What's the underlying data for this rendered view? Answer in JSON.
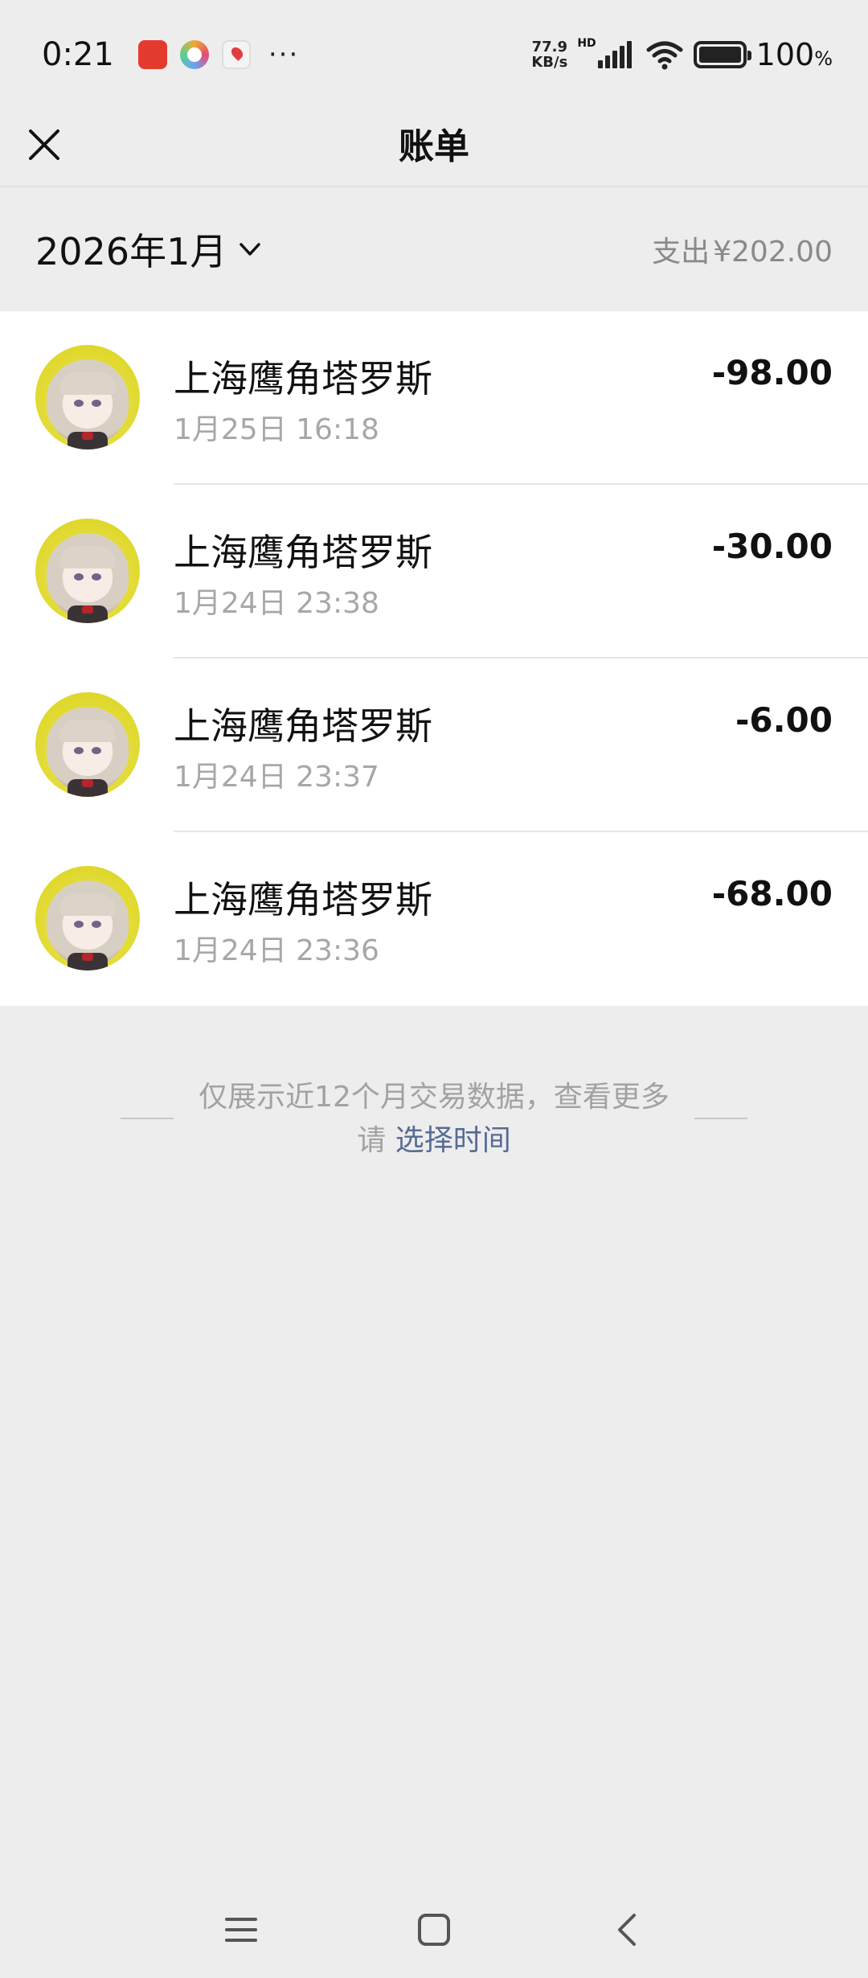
{
  "status_bar": {
    "time": "0:21",
    "more": "···",
    "net_speed_value": "77.9",
    "net_speed_unit": "KB/s",
    "network_label": "HD",
    "battery": "100",
    "battery_unit": "%"
  },
  "header": {
    "title": "账单"
  },
  "month_bar": {
    "month": "2026年1月",
    "summary_label": "支出",
    "summary_amount": "¥202.00"
  },
  "bills": [
    {
      "name": "上海鹰角塔罗斯",
      "time": "1月25日 16:18",
      "amount": "-98.00"
    },
    {
      "name": "上海鹰角塔罗斯",
      "time": "1月24日 23:38",
      "amount": "-30.00"
    },
    {
      "name": "上海鹰角塔罗斯",
      "time": "1月24日 23:37",
      "amount": "-6.00"
    },
    {
      "name": "上海鹰角塔罗斯",
      "time": "1月24日 23:36",
      "amount": "-68.00"
    }
  ],
  "footer_note": {
    "text": "仅展示近12个月交易数据，查看更多请",
    "link": "选择时间"
  },
  "colors": {
    "background": "#ededed",
    "list_background": "#ffffff",
    "link": "#576b95",
    "secondary_text": "#a7a7a7"
  }
}
